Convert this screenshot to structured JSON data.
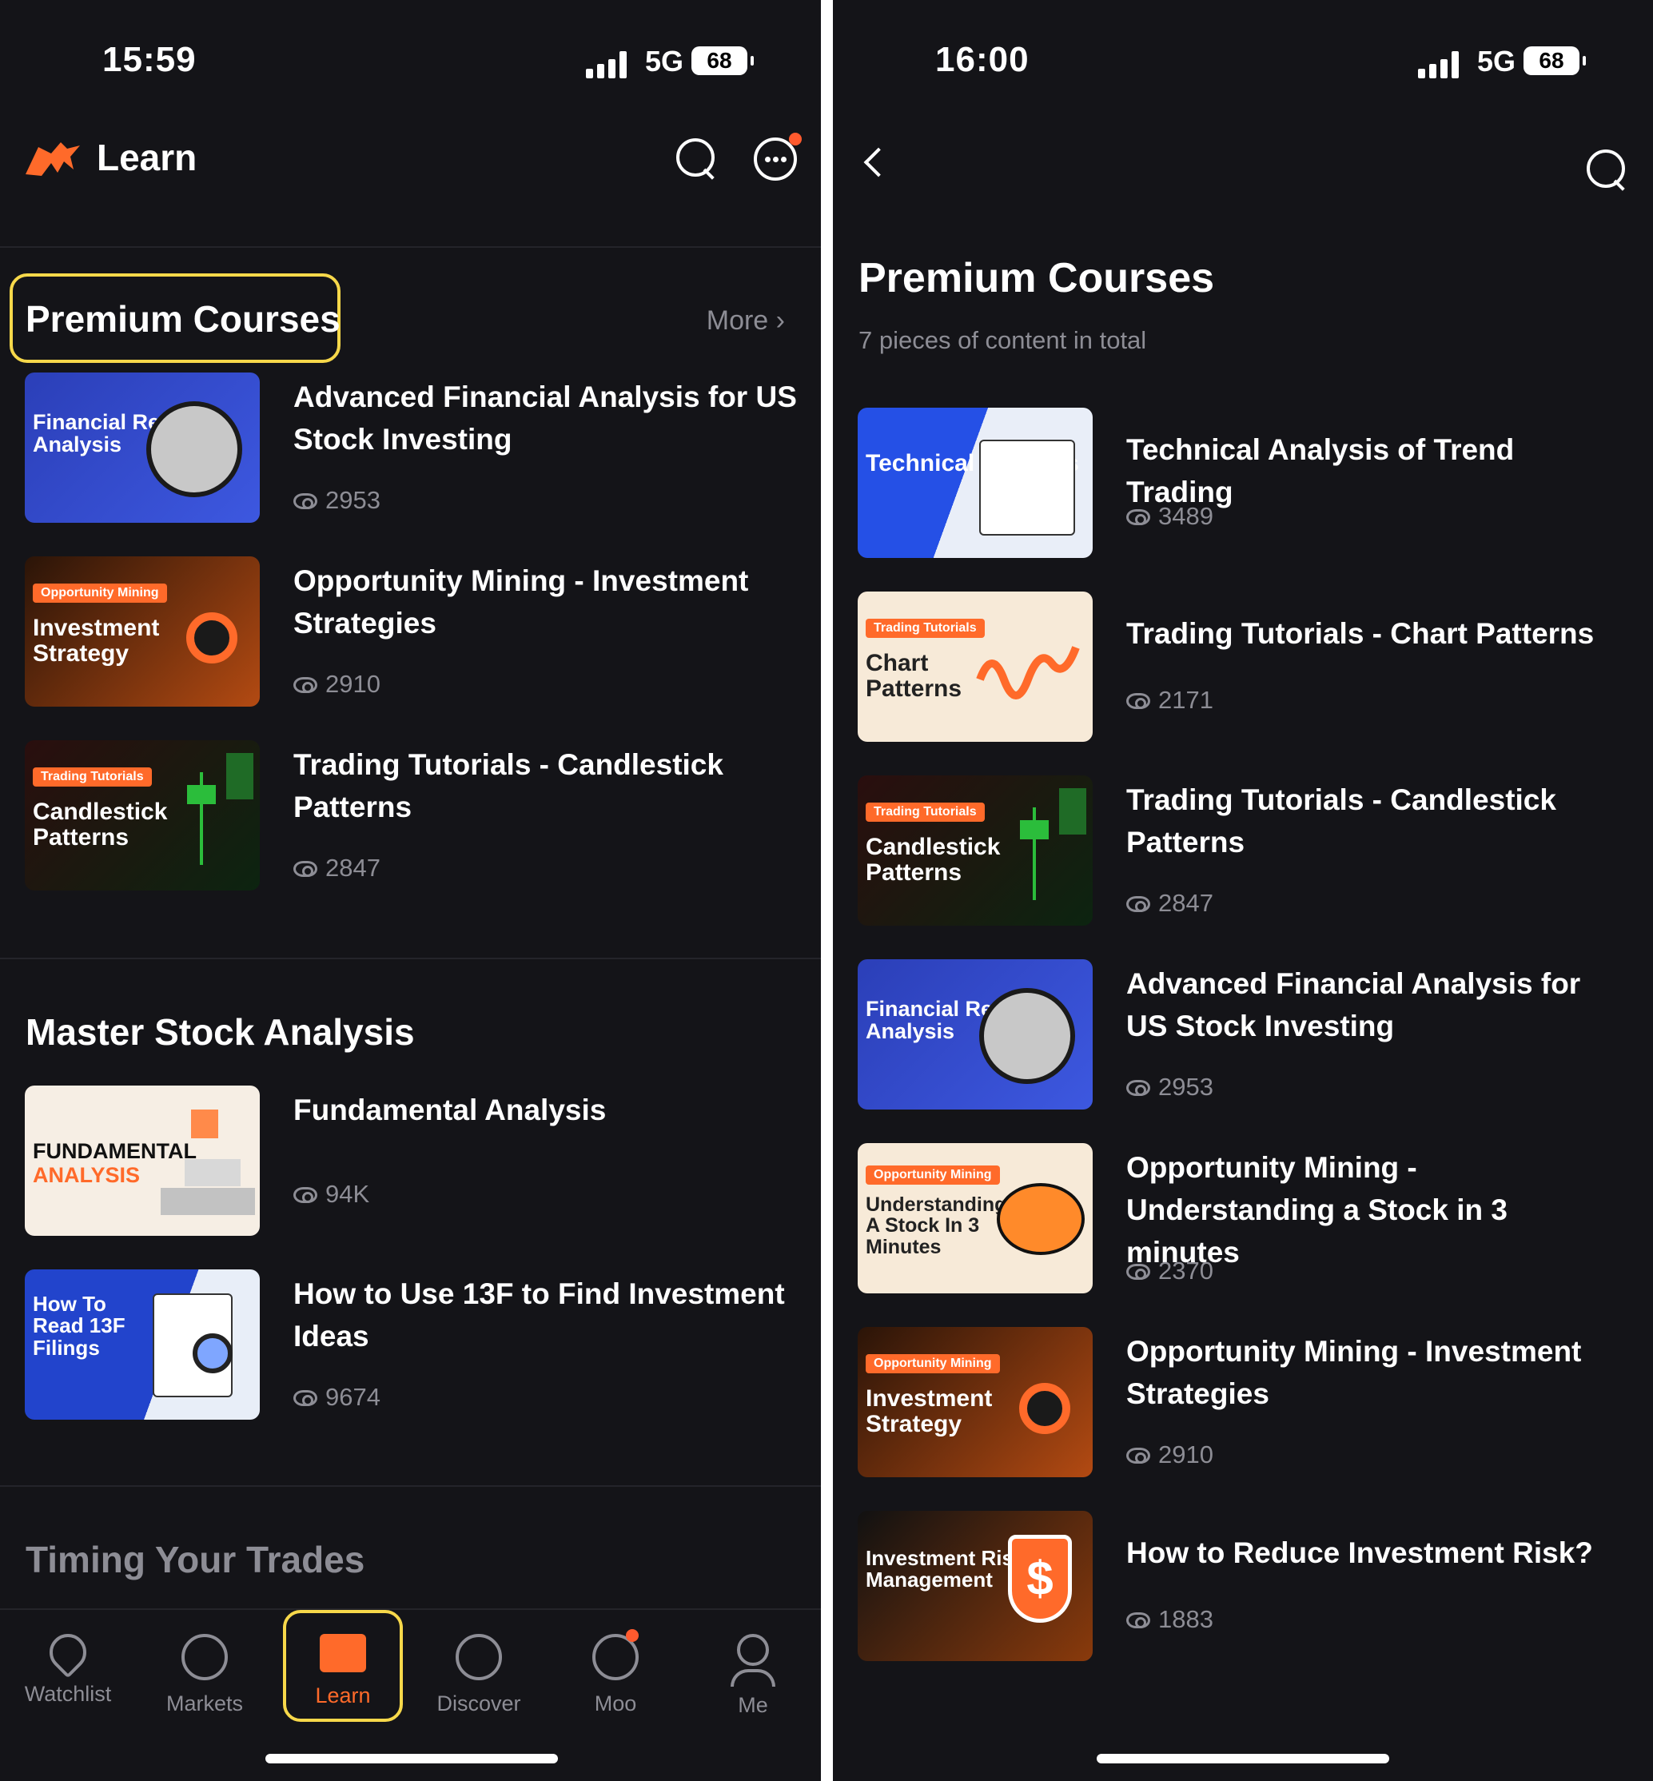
{
  "left": {
    "status": {
      "time": "15:59",
      "network": "5G",
      "battery": "68"
    },
    "header": {
      "title": "Learn"
    },
    "premium": {
      "title": "Premium Courses",
      "more": "More",
      "items": [
        {
          "title": "Advanced Financial Analysis for US Stock Investing",
          "views": "2953",
          "thumb": {
            "tag": "",
            "text": "Financial Report Analysis"
          }
        },
        {
          "title": "Opportunity Mining - Investment Strategies",
          "views": "2910",
          "thumb": {
            "tag": "Opportunity Mining",
            "text": "Investment Strategy"
          }
        },
        {
          "title": "Trading Tutorials - Candlestick Patterns",
          "views": "2847",
          "thumb": {
            "tag": "Trading Tutorials",
            "text": "Candlestick Patterns"
          }
        }
      ]
    },
    "master": {
      "title": "Master Stock Analysis",
      "items": [
        {
          "title": "Fundamental Analysis",
          "views": "94K",
          "thumb": {
            "text1": "FUNDAMENTAL",
            "text2": "ANALYSIS"
          }
        },
        {
          "title": "How to Use 13F to Find Investment Ideas",
          "views": "9674",
          "thumb": {
            "text": "How To Read 13F Filings"
          }
        }
      ]
    },
    "timing": {
      "title": "Timing Your Trades"
    },
    "tabs": [
      "Watchlist",
      "Markets",
      "Learn",
      "Discover",
      "Moo",
      "Me"
    ]
  },
  "right": {
    "status": {
      "time": "16:00",
      "network": "5G",
      "battery": "68"
    },
    "title": "Premium Courses",
    "subtitle": "7 pieces of content in total",
    "items": [
      {
        "title": "Technical Analysis of Trend Trading",
        "views": "3489",
        "thumb": {
          "tag": "",
          "text": "Technical Analysis"
        }
      },
      {
        "title": "Trading Tutorials - Chart Patterns",
        "views": "2171",
        "thumb": {
          "tag": "Trading Tutorials",
          "text": "Chart Patterns"
        }
      },
      {
        "title": "Trading Tutorials - Candlestick Patterns",
        "views": "2847",
        "thumb": {
          "tag": "Trading Tutorials",
          "text": "Candlestick Patterns"
        }
      },
      {
        "title": "Advanced Financial Analysis for US Stock Investing",
        "views": "2953",
        "thumb": {
          "tag": "",
          "text": "Financial Report Analysis"
        }
      },
      {
        "title": "Opportunity Mining - Understanding a Stock in 3 minutes",
        "views": "2370",
        "thumb": {
          "tag": "Opportunity Mining",
          "text": "Understanding A Stock In 3 Minutes"
        }
      },
      {
        "title": "Opportunity Mining - Investment Strategies",
        "views": "2910",
        "thumb": {
          "tag": "Opportunity Mining",
          "text": "Investment Strategy"
        }
      },
      {
        "title": "How to Reduce Investment Risk?",
        "views": "1883",
        "thumb": {
          "tag": "",
          "text": "Investment Risk Management"
        }
      }
    ]
  }
}
